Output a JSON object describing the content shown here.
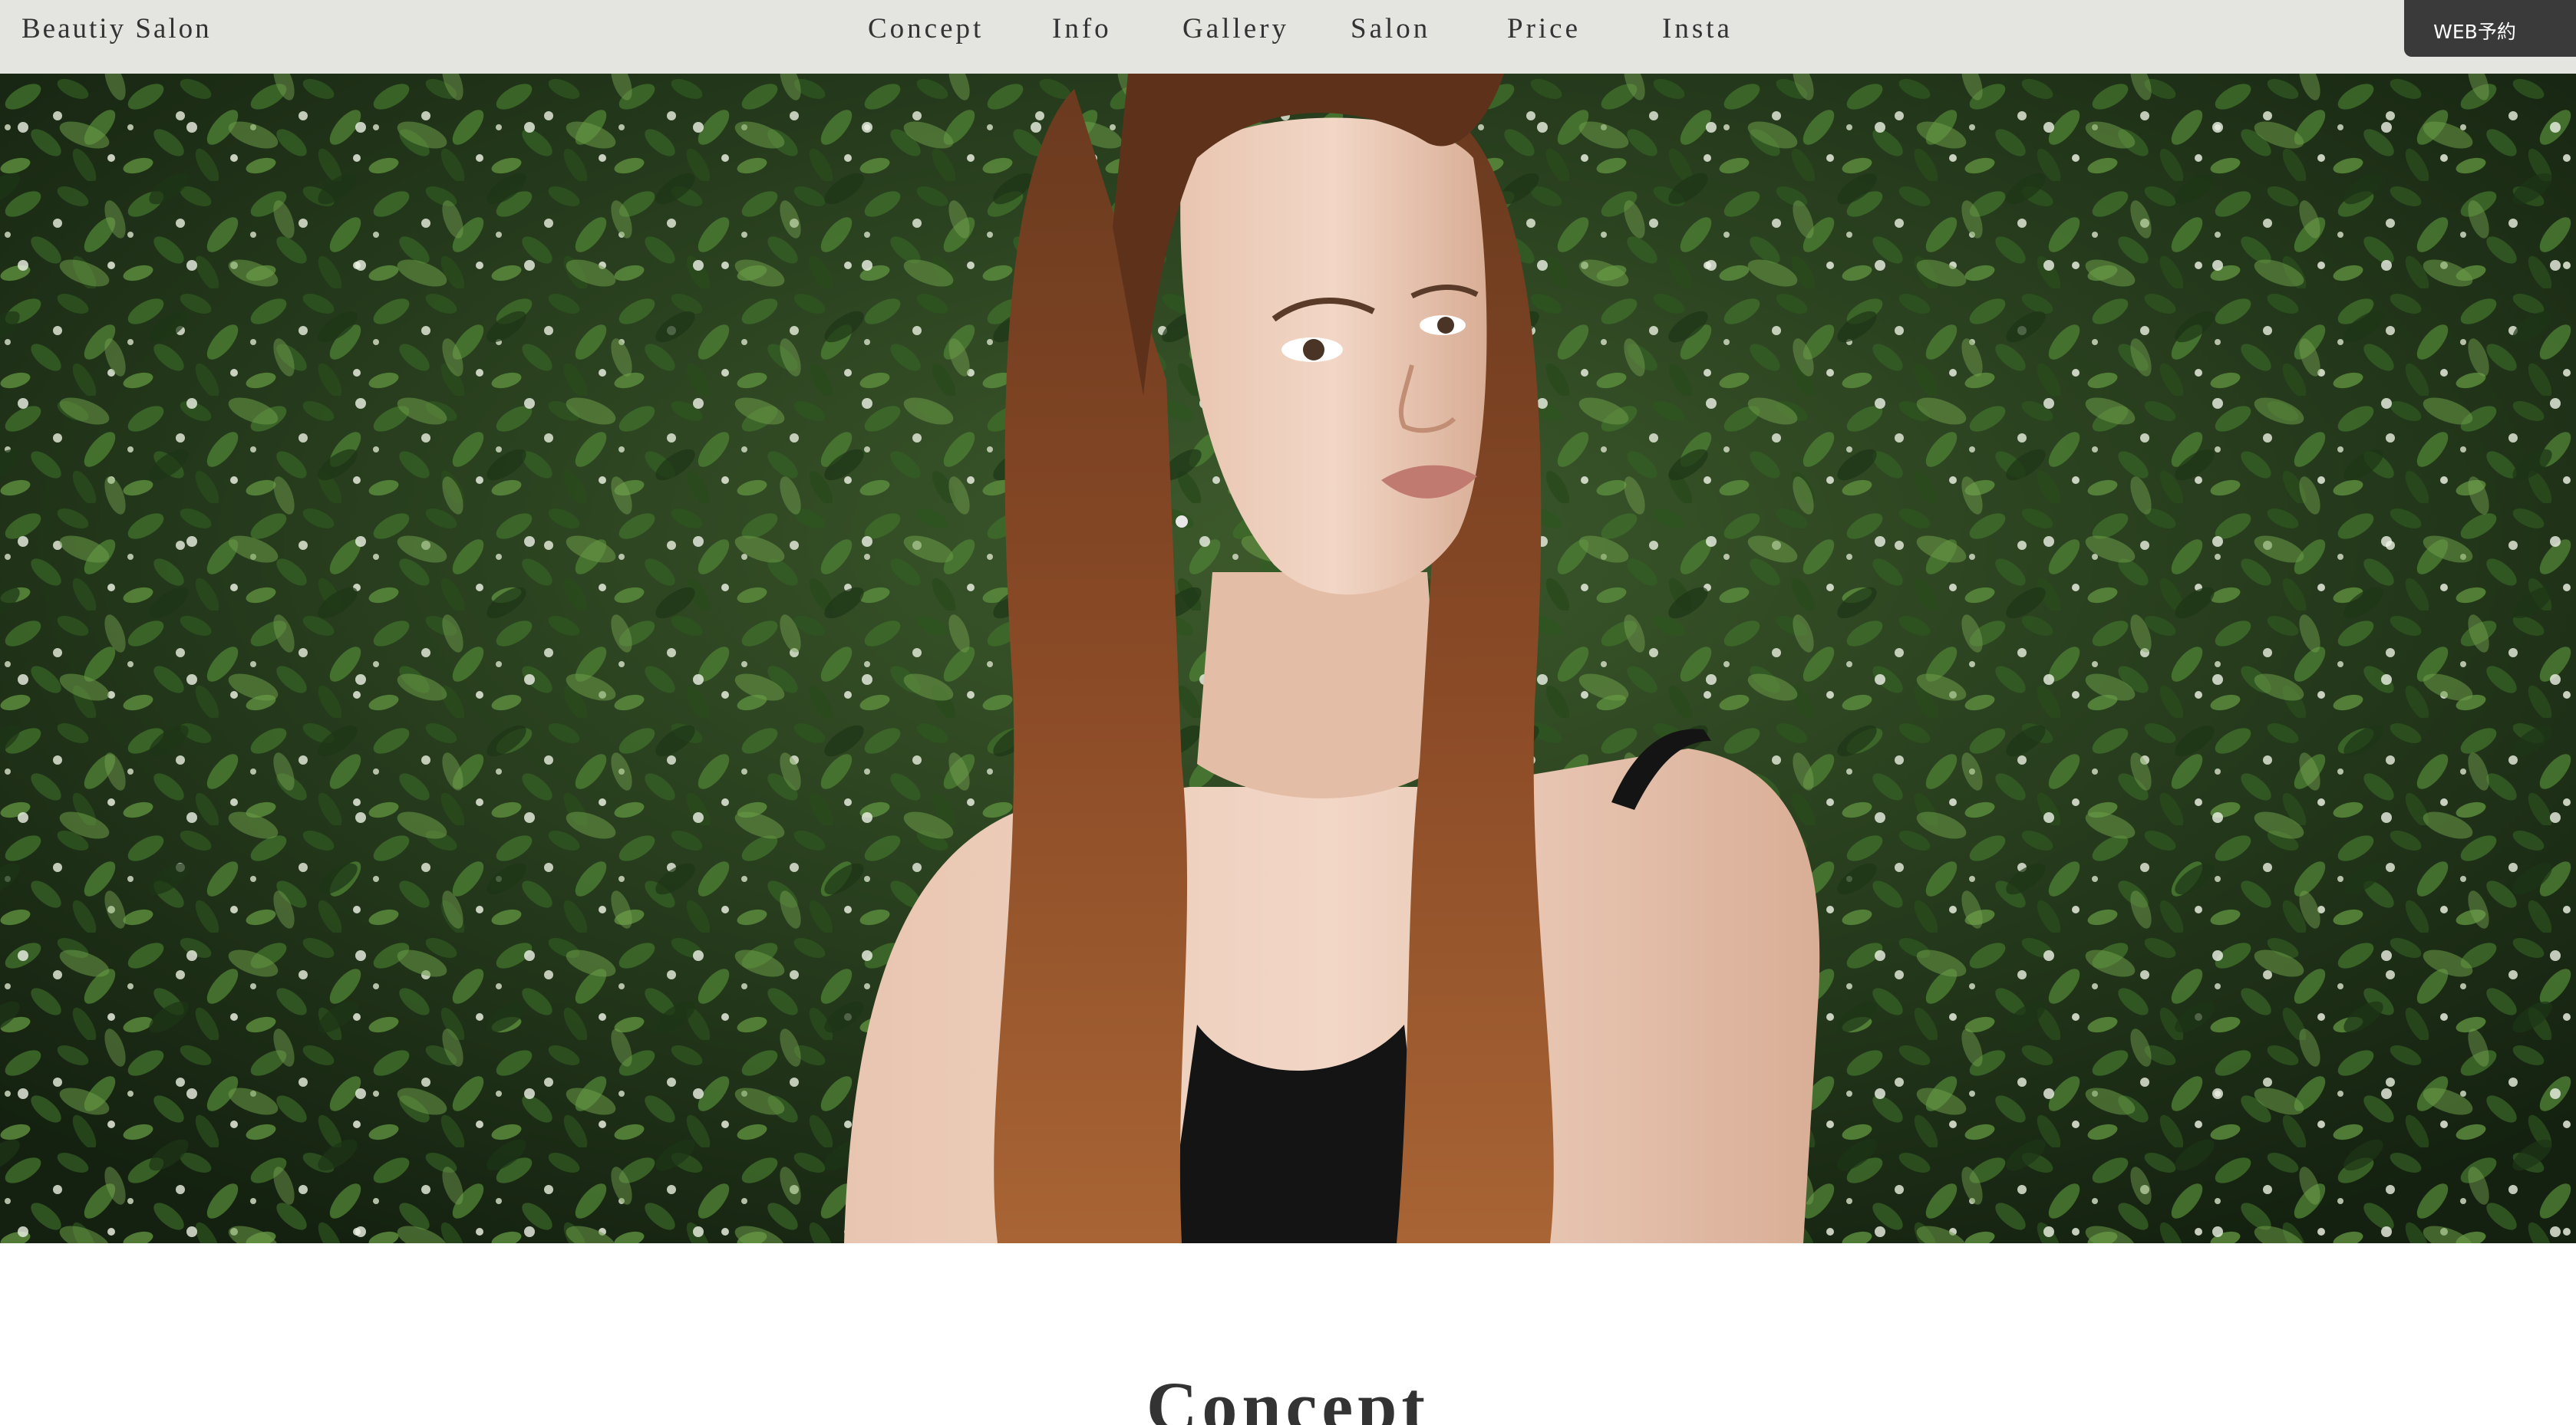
{
  "header": {
    "brand": "Beautiy Salon",
    "nav": [
      "Concept",
      "Info",
      "Gallery",
      "Salon",
      "Price",
      "Insta"
    ],
    "cta_label": "WEB予約"
  },
  "hero": {
    "image": "portrait-photo"
  },
  "concept": {
    "title": "Concept"
  },
  "colors": {
    "header_bg": "#e4e4e1",
    "text": "#333333",
    "cta_bg": "#3a3a3a",
    "cta_text": "#ffffff",
    "foliage": "#2c4a22"
  }
}
